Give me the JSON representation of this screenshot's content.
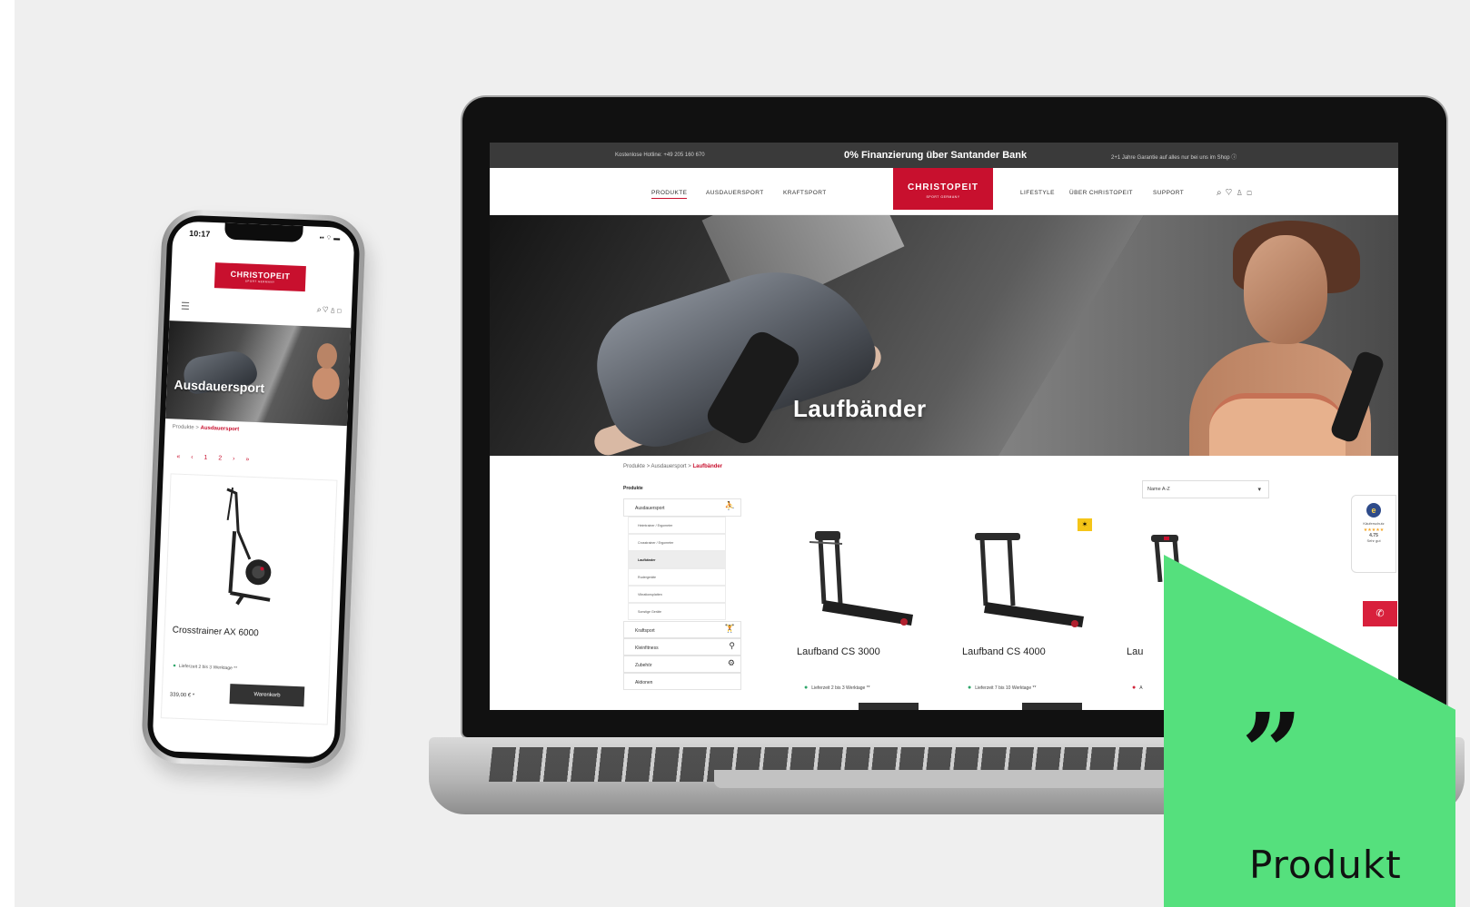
{
  "phone": {
    "time": "10:17",
    "status": "▪▪ ⌔ ▬",
    "logo": "CHRISTOPEIT",
    "logo_sub": "SPORT GERMANY",
    "menu_icon": "menu-icon",
    "header_icons": "⌕♡♙◻",
    "hero_title": "Ausdauersport",
    "breadcrumb_root": "Produkte",
    "breadcrumb_sep": ">",
    "breadcrumb_current": "Ausdauersport",
    "pager": "« ‹ 1 2 › »",
    "product": {
      "name": "Crosstrainer AX 6000",
      "stock": "Lieferzeit 2 bis 3 Werktage **",
      "price": "339,00 € *",
      "button": "Warenkorb"
    }
  },
  "laptop": {
    "topbar": {
      "hotline": "Kostenlose Hotline: +49 205 160 670",
      "financing": "0% Finanzierung über Santander Bank",
      "warranty": "2+1 Jahre Garantie auf alles nur bei uns im Shop ⓘ"
    },
    "nav_left": [
      "PRODUKTE",
      "AUSDAUERSPORT",
      "KRAFTSPORT"
    ],
    "nav_right": [
      "LIFESTYLE",
      "ÜBER CHRISTOPEIT",
      "SUPPORT"
    ],
    "logo": "CHRISTOPEIT",
    "logo_sub": "SPORT GERMANY",
    "nav_icons": "⌕♡♙◻",
    "hero_title": "Laufbänder",
    "breadcrumb": [
      "Produkte",
      "Ausdauersport",
      "Laufbänder"
    ],
    "breadcrumb_sep": ">",
    "facets_title": "Produkte",
    "facets": [
      {
        "label": "Ausdauersport",
        "icon": "⛹"
      },
      {
        "label": "Kraftsport",
        "icon": "🏋"
      },
      {
        "label": "Kleinfitness",
        "icon": "⚲"
      },
      {
        "label": "Zubehör",
        "icon": "⚙"
      },
      {
        "label": "Aktionen",
        "icon": ""
      }
    ],
    "subcategories": [
      "Heimtrainer / Ergometer",
      "Crosstrainer / Ergometer",
      "Laufbänder",
      "Rudergeräte",
      "Vibrationsplatten",
      "Sonstige Geräte"
    ],
    "sort": "Name A-Z",
    "badge": "✶",
    "products": [
      {
        "name": "Laufband CS 3000",
        "stock": "Lieferzeit 2 bis 3 Werktage **",
        "stock_status": "green"
      },
      {
        "name": "Laufband CS 4000",
        "stock": "Lieferzeit 7 bis 10 Werktage **",
        "stock_status": "green"
      },
      {
        "name": "Lau",
        "stock": "A",
        "stock_status": "red"
      }
    ],
    "trust": {
      "label": "Käuferschutz",
      "stars": "★★★★★",
      "score": "4.75",
      "rating": "Sehr gut",
      "logo": "e"
    },
    "call_icon": "✆"
  },
  "quote": {
    "mark": "”",
    "text": "Produkt"
  },
  "colors": {
    "brand_red": "#c8102e",
    "quote_green": "#55e07d",
    "stock_green": "#2fa66a"
  }
}
